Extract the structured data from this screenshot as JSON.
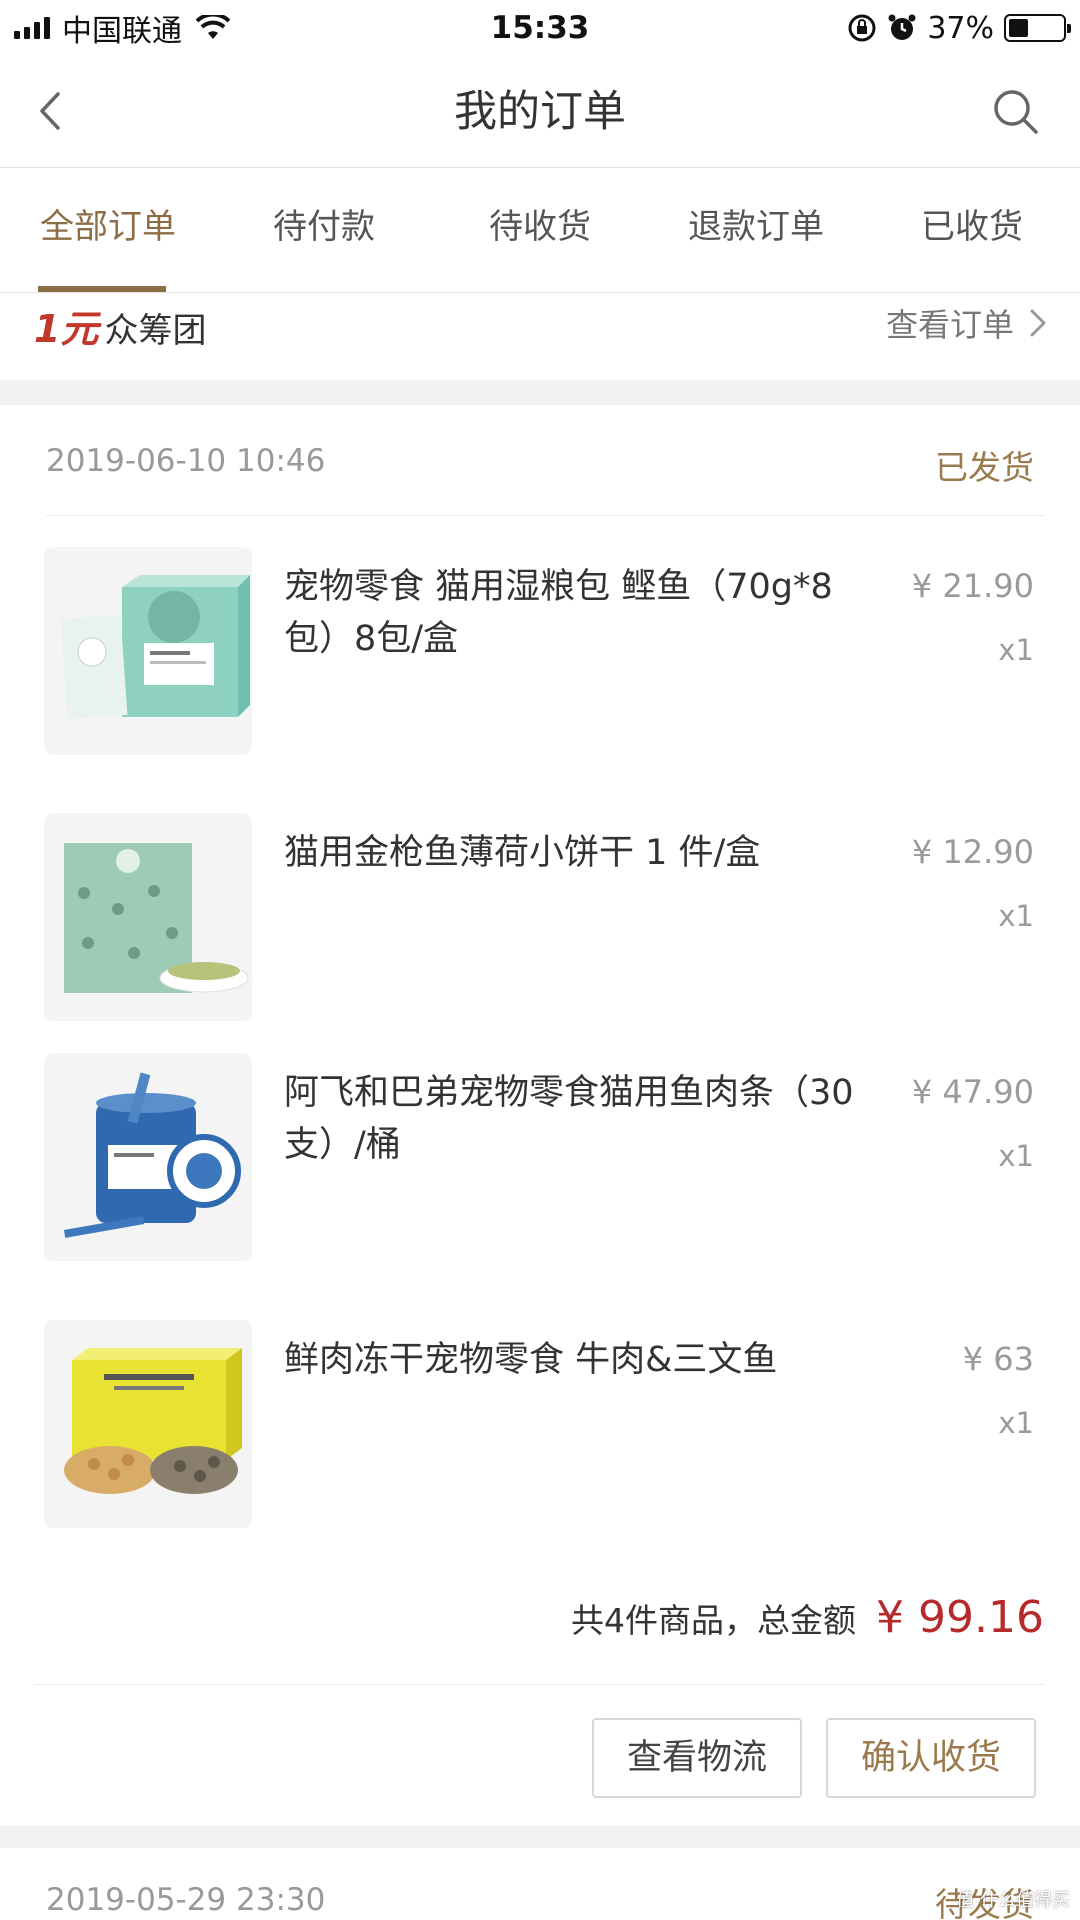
{
  "status_bar": {
    "carrier": "中国联通",
    "time": "15:33",
    "battery_percent": "37%",
    "battery_level": 0.37
  },
  "nav": {
    "title": "我的订单"
  },
  "tabs": [
    {
      "label": "全部订单",
      "active": true
    },
    {
      "label": "待付款",
      "active": false
    },
    {
      "label": "待收货",
      "active": false
    },
    {
      "label": "退款订单",
      "active": false
    },
    {
      "label": "已收货",
      "active": false
    }
  ],
  "crowdfunding": {
    "amount": "1元",
    "name": "众筹团",
    "link": "查看订单"
  },
  "orders": [
    {
      "date": "2019-06-10 10:46",
      "status": "已发货",
      "items": [
        {
          "name": "宠物零食 猫用湿粮包 鲣鱼（70g*8包）8包/盒",
          "price": "¥ 21.90",
          "qty": "x1",
          "image": "teal-wet-food-box"
        },
        {
          "name": "猫用金枪鱼薄荷小饼干 1 件/盒",
          "price": "¥ 12.90",
          "qty": "x1",
          "image": "green-biscuit-bag"
        },
        {
          "name": "阿飞和巴弟宠物零食猫用鱼肉条（30支）/桶",
          "price": "¥ 47.90",
          "qty": "x1",
          "image": "blue-fish-stick-tub"
        },
        {
          "name": "鲜肉冻干宠物零食 牛肉&三文鱼",
          "price": "¥ 63",
          "qty": "x1",
          "image": "yellow-freeze-dried-box"
        }
      ],
      "summary_text": "共4件商品，总金额",
      "total": "¥ 99.16",
      "actions": {
        "logistics": "查看物流",
        "confirm": "确认收货"
      }
    },
    {
      "date": "2019-05-29 23:30",
      "status": "待发货"
    }
  ],
  "watermark": "值 什么值得买",
  "colors": {
    "accent": "#8c6d46",
    "status": "#9a7a4c",
    "price_total": "#b52a2a",
    "divider": "#e3e3e3",
    "gap": "#f2f2f2"
  }
}
